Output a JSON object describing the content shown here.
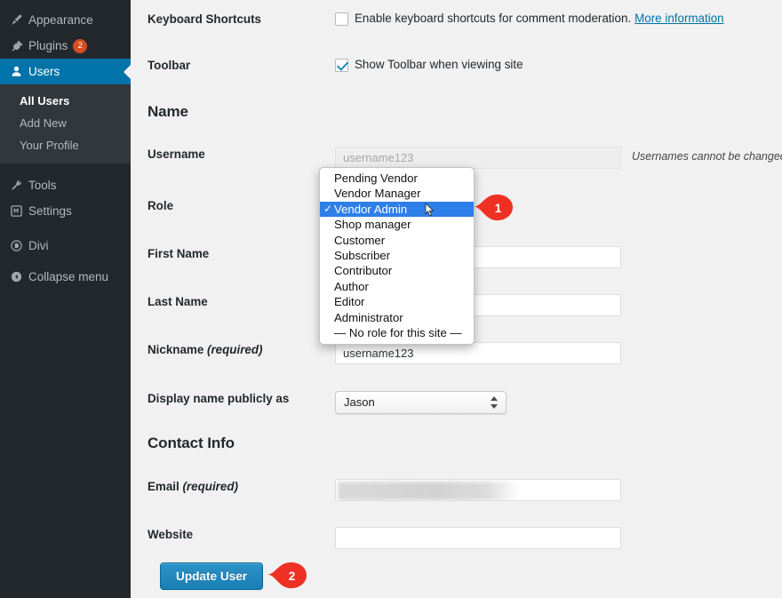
{
  "sidebar": {
    "items": [
      {
        "label": "Appearance",
        "icon": "appearance-icon",
        "badge": null,
        "active": false
      },
      {
        "label": "Plugins",
        "icon": "plugins-icon",
        "badge": "2",
        "active": false
      },
      {
        "label": "Users",
        "icon": "users-icon",
        "badge": null,
        "active": true
      }
    ],
    "submenu": [
      {
        "label": "All Users",
        "current": true
      },
      {
        "label": "Add New",
        "current": false
      },
      {
        "label": "Your Profile",
        "current": false
      }
    ],
    "items_lower": [
      {
        "label": "Tools",
        "icon": "tools-icon"
      },
      {
        "label": "Settings",
        "icon": "settings-icon"
      }
    ],
    "items_bottom": [
      {
        "label": "Divi",
        "icon": "divi-icon"
      },
      {
        "label": "Collapse menu",
        "icon": "collapse-icon"
      }
    ],
    "colors": {
      "background": "#23282d",
      "submenu_background": "#32373c",
      "active": "#0073aa",
      "badge": "#d54e21"
    }
  },
  "main": {
    "keyboard_shortcuts": {
      "label": "Keyboard Shortcuts",
      "checkbox_text": "Enable keyboard shortcuts for comment moderation.",
      "link_text": "More information",
      "checked": false
    },
    "toolbar": {
      "label": "Toolbar",
      "checkbox_text": "Show Toolbar when viewing site",
      "checked": true
    },
    "name_heading": "Name",
    "username": {
      "label": "Username",
      "value": "username123",
      "hint": "Usernames cannot be changed.",
      "disabled": true
    },
    "role": {
      "label": "Role",
      "selected": "Vendor Admin"
    },
    "first_name": {
      "label": "First Name",
      "value": ""
    },
    "last_name": {
      "label": "Last Name",
      "value": ""
    },
    "nickname": {
      "label": "Nickname",
      "label_required": "(required)",
      "value": "username123"
    },
    "display_name": {
      "label": "Display name publicly as",
      "selected": "Jason"
    },
    "contact_heading": "Contact Info",
    "email": {
      "label": "Email",
      "label_required": "(required)",
      "value": "",
      "redacted": true
    },
    "website": {
      "label": "Website",
      "value": ""
    },
    "update_button": "Update User"
  },
  "role_dropdown": {
    "options": [
      "Pending Vendor",
      "Vendor Manager",
      "Vendor Admin",
      "Shop manager",
      "Customer",
      "Subscriber",
      "Contributor",
      "Author",
      "Editor",
      "Administrator",
      "— No role for this site —"
    ],
    "selected_index": 2,
    "selected_mark": "✓",
    "highlight_color": "#2f7fe8"
  },
  "callouts": [
    {
      "number": "1",
      "color": "#ee3124"
    },
    {
      "number": "2",
      "color": "#ee3124"
    }
  ]
}
